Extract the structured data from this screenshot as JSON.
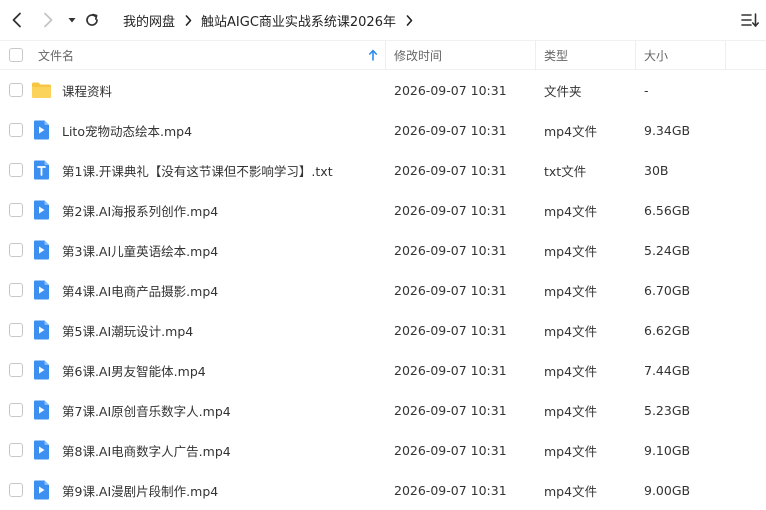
{
  "breadcrumb": {
    "items": [
      "我的网盘",
      "触站AIGC商业实战系统课2026年"
    ]
  },
  "columns": {
    "name": "文件名",
    "modified": "修改时间",
    "type": "类型",
    "size": "大小"
  },
  "colors": {
    "folder": "#f7c744",
    "video": "#3d8ff0",
    "text_file": "#3d8ff0",
    "sort_arrow": "#2c8cf0"
  },
  "files": [
    {
      "name": "课程资料",
      "modified": "2026-09-07 10:31",
      "type": "文件夹",
      "size": "-",
      "icon": "folder-icon"
    },
    {
      "name": "Lito宠物动态绘本.mp4",
      "modified": "2026-09-07 10:31",
      "type": "mp4文件",
      "size": "9.34GB",
      "icon": "video-file-icon"
    },
    {
      "name": "第1课.开课典礼【没有这节课但不影响学习】.txt",
      "modified": "2026-09-07 10:31",
      "type": "txt文件",
      "size": "30B",
      "icon": "text-file-icon"
    },
    {
      "name": "第2课.AI海报系列创作.mp4",
      "modified": "2026-09-07 10:31",
      "type": "mp4文件",
      "size": "6.56GB",
      "icon": "video-file-icon"
    },
    {
      "name": "第3课.AI儿童英语绘本.mp4",
      "modified": "2026-09-07 10:31",
      "type": "mp4文件",
      "size": "5.24GB",
      "icon": "video-file-icon"
    },
    {
      "name": "第4课.AI电商产品摄影.mp4",
      "modified": "2026-09-07 10:31",
      "type": "mp4文件",
      "size": "6.70GB",
      "icon": "video-file-icon"
    },
    {
      "name": "第5课.AI潮玩设计.mp4",
      "modified": "2026-09-07 10:31",
      "type": "mp4文件",
      "size": "6.62GB",
      "icon": "video-file-icon"
    },
    {
      "name": "第6课.AI男友智能体.mp4",
      "modified": "2026-09-07 10:31",
      "type": "mp4文件",
      "size": "7.44GB",
      "icon": "video-file-icon"
    },
    {
      "name": "第7课.AI原创音乐数字人.mp4",
      "modified": "2026-09-07 10:31",
      "type": "mp4文件",
      "size": "5.23GB",
      "icon": "video-file-icon"
    },
    {
      "name": "第8课.AI电商数字人广告.mp4",
      "modified": "2026-09-07 10:31",
      "type": "mp4文件",
      "size": "9.10GB",
      "icon": "video-file-icon"
    },
    {
      "name": "第9课.AI漫剧片段制作.mp4",
      "modified": "2026-09-07 10:31",
      "type": "mp4文件",
      "size": "9.00GB",
      "icon": "video-file-icon"
    }
  ]
}
